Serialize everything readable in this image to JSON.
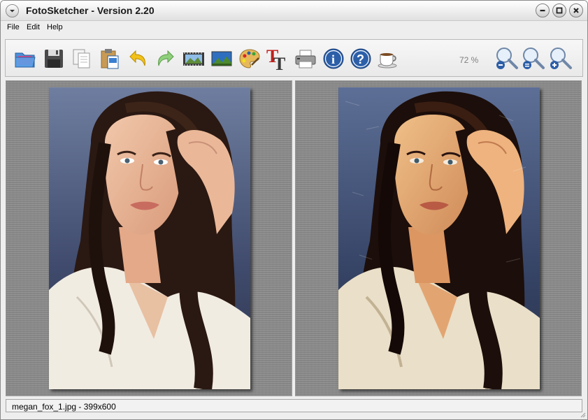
{
  "window": {
    "title": "FotoSketcher - Version 2.20"
  },
  "menu": {
    "items": [
      "File",
      "Edit",
      "Help"
    ]
  },
  "toolbar": {
    "buttons": [
      {
        "name": "open-icon",
        "color": "#3a7fd0"
      },
      {
        "name": "save-icon",
        "color": "#444444"
      },
      {
        "name": "copy-icon",
        "color": "#cfcfcf"
      },
      {
        "name": "paste-icon",
        "color": "#3a7fd0"
      },
      {
        "name": "undo-icon",
        "color": "#e8b400"
      },
      {
        "name": "redo-icon",
        "color": "#7cc36b"
      },
      {
        "name": "filmstrip-icon",
        "color": "#444444"
      },
      {
        "name": "landscape-icon",
        "color": "#3a7fd0"
      },
      {
        "name": "palette-icon",
        "color": "#e8b400"
      },
      {
        "name": "text-icon",
        "color": "#c0201c"
      },
      {
        "name": "printer-icon",
        "color": "#777777"
      },
      {
        "name": "info-icon",
        "color": "#2d5fa8"
      },
      {
        "name": "help-icon",
        "color": "#2d5fa8"
      },
      {
        "name": "coffee-icon",
        "color": "#ffffff"
      },
      {
        "name": "zoom-out-icon",
        "color": "#2d5fa8"
      },
      {
        "name": "zoom-fit-icon",
        "color": "#2d5fa8"
      },
      {
        "name": "zoom-in-icon",
        "color": "#2d5fa8"
      }
    ],
    "zoom_level": "72 %"
  },
  "status": {
    "text": "megan_fox_1.jpg - 399x600"
  },
  "colors": {
    "panel_bg": "#8c8c8c",
    "window_bg": "#eeeeee"
  }
}
